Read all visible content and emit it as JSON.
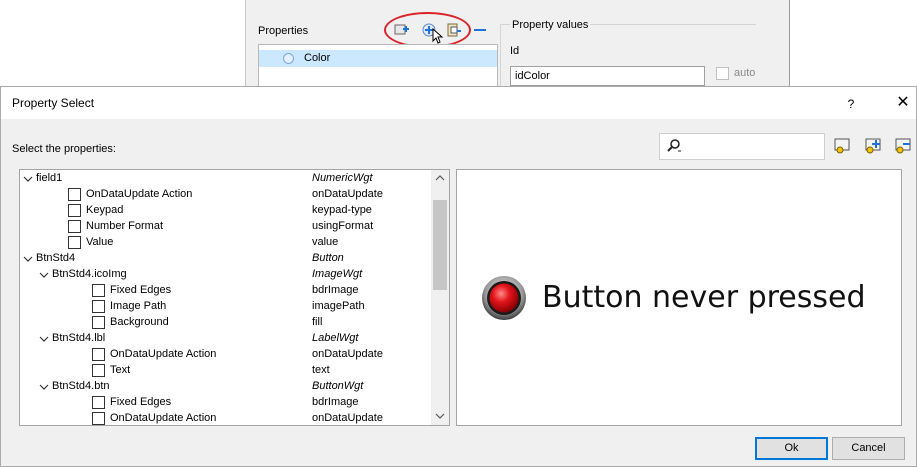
{
  "background_window": {
    "properties_label": "Properties",
    "tree_item": "Color",
    "property_values_label": "Property values",
    "id_label": "Id",
    "id_value": "idColor",
    "auto_label": "auto"
  },
  "dialog": {
    "title": "Property Select",
    "help_label": "?",
    "close_label": "✕",
    "select_label": "Select the properties:",
    "search": {
      "value": ""
    },
    "tree": [
      {
        "label": "field1",
        "prop": "NumericWgt",
        "italic": true,
        "expanded": true,
        "level": 0,
        "checkbox": false
      },
      {
        "label": "OnDataUpdate Action",
        "prop": "onDataUpdate",
        "level": 1,
        "checkbox": true
      },
      {
        "label": "Keypad",
        "prop": "keypad-type",
        "level": 1,
        "checkbox": true
      },
      {
        "label": "Number Format",
        "prop": "usingFormat",
        "level": 1,
        "checkbox": true
      },
      {
        "label": "Value",
        "prop": "value",
        "level": 1,
        "checkbox": true
      },
      {
        "label": "BtnStd4",
        "prop": "Button",
        "italic": true,
        "expanded": true,
        "level": 0,
        "checkbox": false
      },
      {
        "label": "BtnStd4.icoImg",
        "prop": "ImageWgt",
        "italic": true,
        "expanded": true,
        "level": 1,
        "checkbox": false
      },
      {
        "label": "Fixed Edges",
        "prop": "bdrImage",
        "level": 2,
        "checkbox": true
      },
      {
        "label": "Image Path",
        "prop": "imagePath",
        "level": 2,
        "checkbox": true
      },
      {
        "label": "Background",
        "prop": "fill",
        "level": 2,
        "checkbox": true
      },
      {
        "label": "BtnStd4.lbl",
        "prop": "LabelWgt",
        "italic": true,
        "expanded": true,
        "level": 1,
        "checkbox": false
      },
      {
        "label": "OnDataUpdate Action",
        "prop": "onDataUpdate",
        "level": 2,
        "checkbox": true
      },
      {
        "label": "Text",
        "prop": "text",
        "level": 2,
        "checkbox": true
      },
      {
        "label": "BtnStd4.btn",
        "prop": "ButtonWgt",
        "italic": true,
        "expanded": true,
        "level": 1,
        "checkbox": false
      },
      {
        "label": "Fixed Edges",
        "prop": "bdrImage",
        "level": 2,
        "checkbox": true
      },
      {
        "label": "OnDataUpdate Action",
        "prop": "onDataUpdate",
        "level": 2,
        "checkbox": true
      }
    ],
    "preview_text": "Button never pressed",
    "ok_label": "Ok",
    "cancel_label": "Cancel"
  },
  "colors": {
    "selection": "#cce8ff",
    "highlight_ellipse": "#d9232a",
    "ok_border": "#0078d7",
    "preview_button_red": "#e3141b"
  },
  "icons": [
    "add-property-icon",
    "add-circle-icon",
    "paste-icon",
    "minus-icon",
    "search-icon",
    "select-icon",
    "select-all-icon",
    "deselect-icon",
    "chevron-down-icon",
    "scroll-up-icon",
    "scroll-down-icon"
  ]
}
